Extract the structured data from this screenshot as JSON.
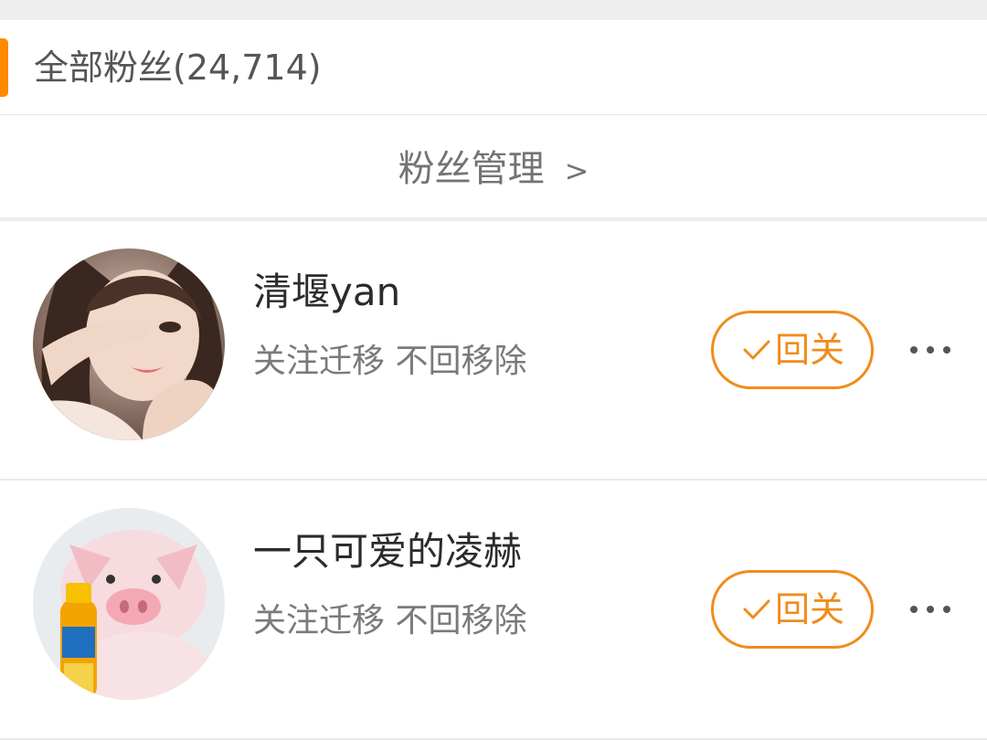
{
  "colors": {
    "accent": "#f08c1c",
    "header_bar": "#ff8a00"
  },
  "header": {
    "title": "全部粉丝(24,714)"
  },
  "manage": {
    "label": "粉丝管理",
    "chevron": ">"
  },
  "fans": [
    {
      "name": "清堰yan",
      "subtitle": "关注迁移 不回移除",
      "follow_label": "回关",
      "avatar": "woman-portrait"
    },
    {
      "name": "一只可爱的凌赫",
      "subtitle": "关注迁移 不回移除",
      "follow_label": "回关",
      "avatar": "piglet-with-drink"
    }
  ]
}
